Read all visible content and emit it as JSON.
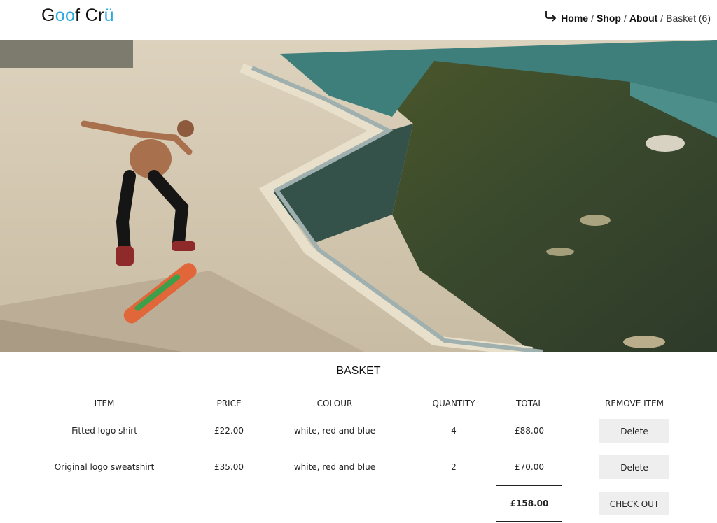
{
  "header": {
    "logo": {
      "part1": "G",
      "part2": "oo",
      "part3": "f Cr",
      "part4": "ü"
    },
    "nav": [
      {
        "label": "Home"
      },
      {
        "label": "Shop"
      },
      {
        "label": "About"
      }
    ],
    "basket_link": "Basket (6)"
  },
  "hero": {
    "description_icon": "skateboarder-photo"
  },
  "basket": {
    "title": "BASKET",
    "columns": [
      "ITEM",
      "PRICE",
      "COLOUR",
      "QUANTITY",
      "TOTAL",
      "REMOVE ITEM"
    ],
    "rows": [
      {
        "item": "Fitted logo shirt",
        "price": "£22.00",
        "colour": "white, red and blue",
        "quantity": "4",
        "total": "£88.00",
        "action": "Delete"
      },
      {
        "item": "Original logo sweatshirt",
        "price": "£35.00",
        "colour": "white, red and blue",
        "quantity": "2",
        "total": "£70.00",
        "action": "Delete"
      }
    ],
    "grand_total": "£158.00",
    "checkout_label": "CHECK OUT"
  },
  "colors": {
    "accent": "#29a9e0",
    "button_bg": "#eeeeee"
  }
}
